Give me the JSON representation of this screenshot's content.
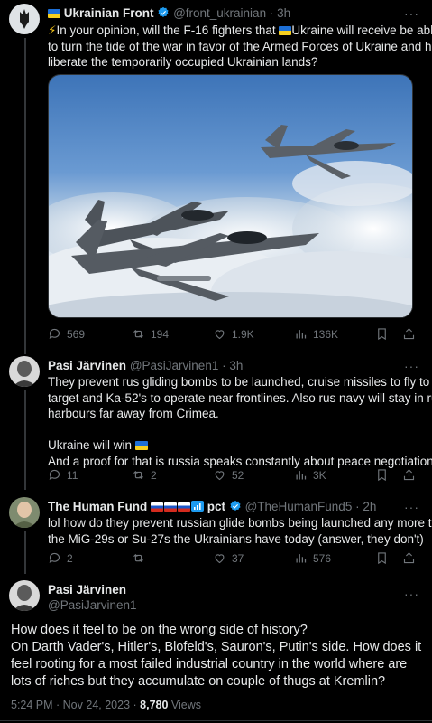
{
  "tweets": [
    {
      "name": "Ukrainian Front",
      "handle": "@front_ukrainian",
      "time": "3h",
      "text_prefix": "⚡",
      "text_line1": "In your opinion, will the F-16 fighters that ",
      "text_line1b": "Ukraine will receive be able",
      "text_line2": "to turn the tide of the war in favor of the Armed Forces of Ukraine and help",
      "text_line3": "liberate the temporarily occupied Ukrainian lands?",
      "stats": {
        "replies": "569",
        "reposts": "194",
        "likes": "1.9K",
        "views": "136K"
      }
    },
    {
      "name": "Pasi Järvinen",
      "handle": "@PasiJarvinen1",
      "time": "3h",
      "lines": [
        "They prevent rus gliding bombs to be launched, cruise missiles to fly to the",
        "target and Ka-52's to operate near frontlines. Also rus navy will stay in rus",
        "harbours far away from Crimea."
      ],
      "line_win": "Ukraine will win ",
      "line_proof": "And a proof for that is russia speaks constantly about peace negotiations",
      "stats": {
        "replies": "11",
        "reposts": "2",
        "likes": "52",
        "views": "3K"
      }
    },
    {
      "name": "The Human Fund",
      "name_suffix": "pct",
      "handle": "@TheHumanFund5",
      "time": "2h",
      "lines": [
        "lol how do they prevent russian glide bombs being launched any more than",
        "the MiG-29s or Su-27s the Ukrainians have today (answer, they don't)"
      ],
      "stats": {
        "replies": "2",
        "reposts": "",
        "likes": "37",
        "views": "576"
      }
    }
  ],
  "main_tweet": {
    "name": "Pasi Järvinen",
    "handle": "@PasiJarvinen1",
    "lines": [
      "How does it feel to be on the wrong side of history?",
      "On Darth Vader's, Hitler's, Blofeld's, Sauron's, Putin's side. How does it",
      "feel rooting for a most failed industrial country in the world where are",
      "lots of riches but they accumulate on couple of thugs at Kremlin?"
    ],
    "meta_time": "5:24 PM · Nov 24, 2023 · ",
    "meta_views_count": "8,780",
    "meta_views_label": " Views"
  },
  "ui": {
    "separator": "·",
    "more": "···"
  },
  "colors": {
    "background": "#000000",
    "text": "#e7e9ea",
    "muted": "#71767b",
    "verified": "#1d9bf0"
  }
}
